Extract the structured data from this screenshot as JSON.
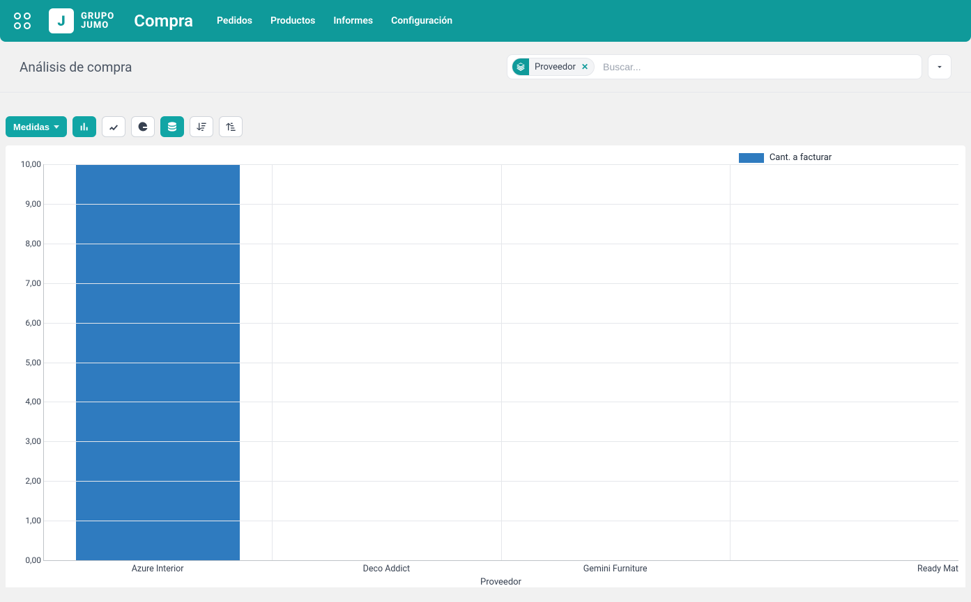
{
  "brand": {
    "line1": "GRUPO",
    "line2": "JUMO",
    "logo_letter": "J"
  },
  "app_title": "Compra",
  "nav": {
    "pedidos": "Pedidos",
    "productos": "Productos",
    "informes": "Informes",
    "configuracion": "Configuración"
  },
  "page_title": "Análisis de compra",
  "search": {
    "facet_label": "Proveedor",
    "placeholder": "Buscar..."
  },
  "toolbar": {
    "medidas": "Medidas"
  },
  "chart_data": {
    "type": "bar",
    "categories": [
      "Azure Interior",
      "Deco Addict",
      "Gemini Furniture",
      "Ready Mat"
    ],
    "values": [
      10.0,
      0.0,
      0.0,
      0.0
    ],
    "title": "",
    "xlabel": "Proveedor",
    "ylabel": "",
    "ylim": [
      0,
      10
    ],
    "yticks": [
      "0,00",
      "1,00",
      "2,00",
      "3,00",
      "4,00",
      "5,00",
      "6,00",
      "7,00",
      "8,00",
      "9,00",
      "10,00"
    ],
    "series": [
      {
        "name": "Cant. a facturar",
        "values": [
          10.0,
          0.0,
          0.0,
          0.0
        ]
      }
    ],
    "legend": "Cant. a facturar",
    "bar_color": "#2f7bbf"
  }
}
